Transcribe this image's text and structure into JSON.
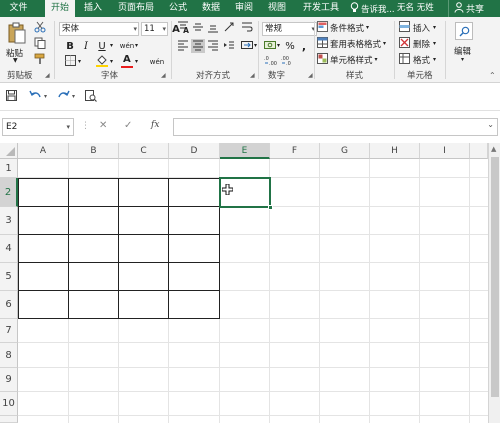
{
  "tabs": [
    {
      "label": "文件",
      "active": false
    },
    {
      "label": "开始",
      "active": true
    },
    {
      "label": "插入",
      "active": false
    },
    {
      "label": "页面布局",
      "active": false
    },
    {
      "label": "公式",
      "active": false
    },
    {
      "label": "数据",
      "active": false
    },
    {
      "label": "审阅",
      "active": false
    },
    {
      "label": "视图",
      "active": false
    },
    {
      "label": "开发工具",
      "active": false
    }
  ],
  "tell_me": "告诉我...",
  "user_name": "无名 无姓",
  "share_label": "共享",
  "ribbon": {
    "clipboard": {
      "paste_label": "粘贴",
      "group_label": "剪贴板"
    },
    "font": {
      "font_name": "宋体",
      "font_size": "11",
      "bold": "B",
      "italic": "I",
      "underline": "U",
      "grow": "A",
      "shrink": "A",
      "font_color_glyph": "A",
      "phonetic": "wén",
      "group_label": "字体"
    },
    "alignment": {
      "group_label": "对齐方式"
    },
    "number": {
      "format": "常规",
      "percent": "%",
      "comma": ",",
      "group_label": "数字"
    },
    "styles": {
      "conditional": "条件格式",
      "table": "套用表格格式",
      "cell_styles": "单元格样式",
      "group_label": "样式"
    },
    "cells": {
      "insert": "插入",
      "delete": "删除",
      "format": "格式",
      "group_label": "单元格"
    },
    "editing": {
      "label": "编辑"
    }
  },
  "formula_bar": {
    "name_box": "E2",
    "fx": "fx",
    "value": ""
  },
  "columns": [
    "A",
    "B",
    "C",
    "D",
    "E",
    "F",
    "G",
    "H",
    "I"
  ],
  "rows": [
    "1",
    "2",
    "3",
    "4",
    "5",
    "6",
    "7",
    "8",
    "9",
    "10"
  ],
  "active_cell": "E2",
  "colors": {
    "accent": "#217346",
    "ribbon_bg": "#f3f3f3",
    "grid_line": "#e4e4e4"
  }
}
